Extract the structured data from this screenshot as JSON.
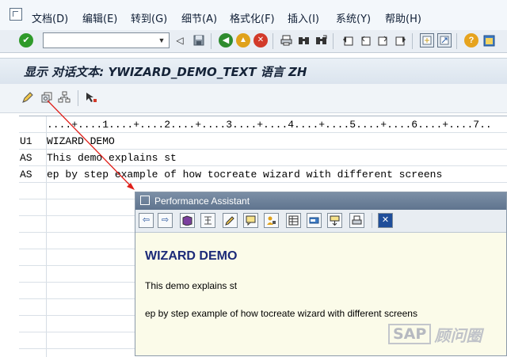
{
  "menubar": {
    "items": [
      {
        "label": "文档(D)"
      },
      {
        "label": "编辑(E)"
      },
      {
        "label": "转到(G)"
      },
      {
        "label": "细节(A)"
      },
      {
        "label": "格式化(F)"
      },
      {
        "label": "插入(I)"
      },
      {
        "label": "系统(Y)"
      },
      {
        "label": "帮助(H)"
      }
    ]
  },
  "toolbar": {
    "command_field_value": ""
  },
  "title": "显示 对话文本: YWIZARD_DEMO_TEXT 语言 ZH",
  "editor": {
    "ruler": "....+....1....+....2....+....3....+....4....+....5....+....6....+....7..",
    "rows": [
      {
        "format": "U1",
        "text": "WIZARD DEMO"
      },
      {
        "format": "AS",
        "text": "This demo explains st"
      },
      {
        "format": "AS",
        "text": "ep by step example of how tocreate wizard with different screens"
      }
    ]
  },
  "popup": {
    "title": "Performance Assistant",
    "heading": "WIZARD DEMO",
    "line1": "This demo explains st",
    "line2": "ep by step example of how tocreate wizard with different screens"
  },
  "watermark": {
    "brand": "SAP",
    "text": "顾问圈"
  },
  "colors": {
    "accent_red": "#e0201a",
    "heading_blue": "#1c2a78",
    "popup_bg": "#fbfbe9"
  }
}
